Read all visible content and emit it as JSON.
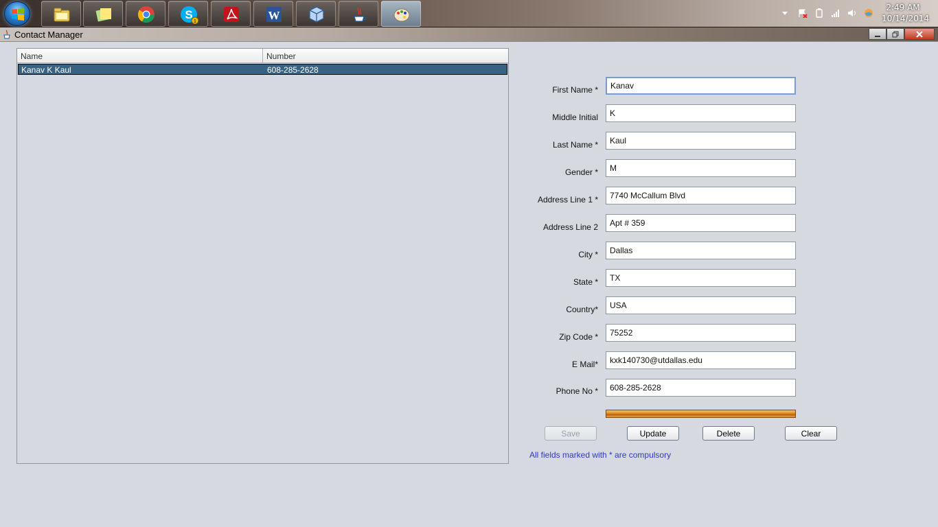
{
  "taskbar": {
    "apps": [
      {
        "icon": "windows-explorer-icon"
      },
      {
        "icon": "sticky-notes-icon"
      },
      {
        "icon": "chrome-icon"
      },
      {
        "icon": "skype-icon",
        "badge": "1"
      },
      {
        "icon": "adobe-reader-icon"
      },
      {
        "icon": "word-icon"
      },
      {
        "icon": "virtualbox-icon"
      },
      {
        "icon": "java-icon"
      },
      {
        "icon": "paint-icon"
      }
    ],
    "clock": {
      "time": "2:49 AM",
      "date": "10/14/2014"
    }
  },
  "window": {
    "title": "Contact Manager",
    "title_icon": "java-icon"
  },
  "table": {
    "columns": [
      "Name",
      "Number"
    ],
    "rows": [
      {
        "name": "Kanav K Kaul",
        "number": "608-285-2628",
        "selected": true
      }
    ]
  },
  "form": {
    "fields": [
      {
        "label": "First Name *",
        "value": "Kanav"
      },
      {
        "label": "Middle Initial",
        "value": "K"
      },
      {
        "label": "Last Name *",
        "value": "Kaul"
      },
      {
        "label": "Gender *",
        "value": "M"
      },
      {
        "label": "Address Line 1 *",
        "value": "7740 McCallum Blvd"
      },
      {
        "label": "Address Line 2",
        "value": "Apt # 359"
      },
      {
        "label": "City *",
        "value": "Dallas"
      },
      {
        "label": "State *",
        "value": "TX"
      },
      {
        "label": "Country*",
        "value": "USA"
      },
      {
        "label": "Zip Code *",
        "value": "75252"
      },
      {
        "label": "E Mail*",
        "value": "kxk140730@utdallas.edu"
      },
      {
        "label": "Phone No *",
        "value": "608-285-2628"
      }
    ],
    "progress_fraction": 1.0,
    "buttons": {
      "save": "Save",
      "update": "Update",
      "delete": "Delete",
      "clear": "Clear"
    },
    "note": "All fields marked with * are compulsory"
  },
  "colors": {
    "selection": "#386282",
    "note_text": "#2f38c8",
    "progress": "#e08a1a"
  }
}
